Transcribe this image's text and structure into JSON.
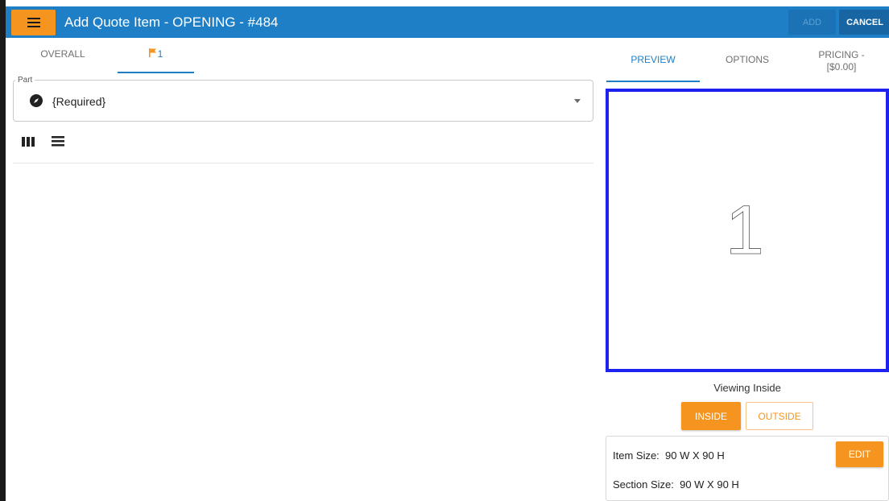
{
  "app": {
    "title": "Add Quote Item - OPENING - #484",
    "menu_icon": "hamburger-icon",
    "add_label": "ADD",
    "cancel_label": "CANCEL"
  },
  "left_panel": {
    "tabs": [
      {
        "label": "OVERALL"
      },
      {
        "icon": "flag-icon",
        "count": "1"
      }
    ],
    "part": {
      "label": "Part",
      "value": "{Required}",
      "icon": "compass-icon",
      "dropdown_icon": "caret-down-icon"
    },
    "view_toggles": [
      "column-view-icon",
      "list-view-icon"
    ]
  },
  "right_panel": {
    "tabs": [
      {
        "label": "PREVIEW"
      },
      {
        "label": "OPTIONS"
      },
      {
        "label_line1": "PRICING -",
        "label_line2": "[$0.00]"
      }
    ],
    "preview": {
      "section_number": "1",
      "viewing_label": "Viewing Inside",
      "inside_label": "INSIDE",
      "outside_label": "OUTSIDE"
    },
    "sizes": {
      "item_size": "Item Size:  90 W X 90 H",
      "section_size": "Section Size:  90 W X 90 H",
      "edit_label": "EDIT"
    }
  },
  "colors": {
    "primary": "#1e7fc7",
    "accent": "#f5951f",
    "preview_border": "#1e22ee"
  }
}
